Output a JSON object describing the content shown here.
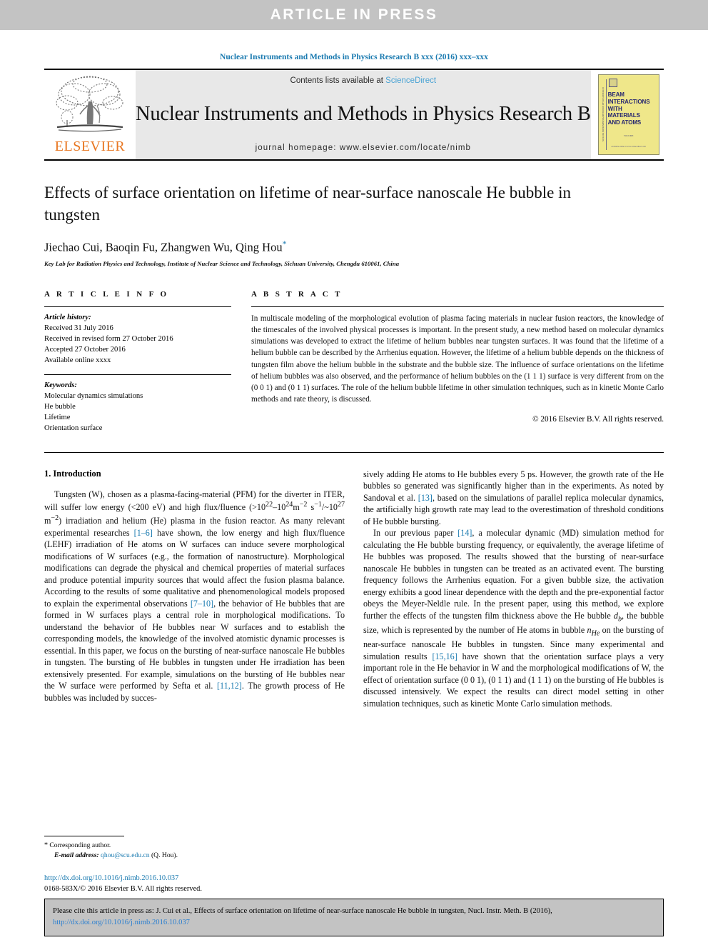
{
  "banner": {
    "text": "ARTICLE  IN  PRESS"
  },
  "running_head": "Nuclear Instruments and Methods in Physics Research B xxx (2016) xxx–xxx",
  "masthead": {
    "contents_prefix": "Contents lists available at ",
    "contents_link": "ScienceDirect",
    "journal_title": "Nuclear Instruments and Methods in Physics Research B",
    "homepage": "journal homepage: www.elsevier.com/locate/nimb",
    "publisher_logo_text": "ELSEVIER",
    "cover": {
      "title_lines": [
        "BEAM",
        "INTERACTIONS",
        "WITH",
        "MATERIALS",
        "AND ATOMS"
      ],
      "spine_text": "NUCLEAR INSTRUMENTS & METHODS IN PHYSICS RESEARCH",
      "volume_text": "VOLUME",
      "footer_text": "Available online at www.sciencedirect.com"
    }
  },
  "article": {
    "title": "Effects of surface orientation on lifetime of near-surface nanoscale He bubble in tungsten",
    "authors": "Jiechao Cui, Baoqin Fu, Zhangwen Wu, Qing Hou",
    "corresponding_marker": "*",
    "affiliation": "Key Lab for Radiation Physics and Technology, Institute of Nuclear Science and Technology, Sichuan University, Chengdu 610061, China"
  },
  "article_info": {
    "heading": "A R T I C L E   I N F O",
    "history_label": "Article history:",
    "history": [
      "Received 31 July 2016",
      "Received in revised form 27 October 2016",
      "Accepted 27 October 2016",
      "Available online xxxx"
    ],
    "keywords_label": "Keywords:",
    "keywords": [
      "Molecular dynamics simulations",
      "He bubble",
      "Lifetime",
      "Orientation surface"
    ]
  },
  "abstract": {
    "heading": "A B S T R A C T",
    "text": "In multiscale modeling of the morphological evolution of plasma facing materials in nuclear fusion reactors, the knowledge of the timescales of the involved physical processes is important. In the present study, a new method based on molecular dynamics simulations was developed to extract the lifetime of helium bubbles near tungsten surfaces. It was found that the lifetime of a helium bubble can be described by the Arrhenius equation. However, the lifetime of a helium bubble depends on the thickness of tungsten film above the helium bubble in the substrate and the bubble size. The influence of surface orientations on the lifetime of helium bubbles was also observed, and the performance of helium bubbles on the (1 1 1) surface is very different from on the (0 0 1) and (0 1 1) surfaces. The role of the helium bubble lifetime in other simulation techniques, such as in kinetic Monte Carlo methods and rate theory, is discussed.",
    "copyright": "© 2016 Elsevier B.V. All rights reserved."
  },
  "body": {
    "section_title": "1. Introduction",
    "left_para1_a": "Tungsten (W), chosen as a plasma-facing-material (PFM) for the diverter in ITER, will suffer low energy (<200 eV) and high flux/fluence (>10",
    "left_para1_sup1": "22",
    "left_para1_b": "–10",
    "left_para1_sup2": "24",
    "left_para1_c": "m",
    "left_para1_sup3": "−2",
    "left_para1_d": " s",
    "left_para1_sup4": "−1",
    "left_para1_e": "/~10",
    "left_para1_sup5": "27",
    "left_para1_f": " m",
    "left_para1_sup6": "−2",
    "left_para1_g": ") irradiation and helium (He) plasma in the fusion reactor. As many relevant experimental researches ",
    "ref_1_6": "[1–6]",
    "left_para1_h": " have shown, the low energy and high flux/fluence (LEHF) irradiation of He atoms on W surfaces can induce severe morphological modifications of W surfaces (e.g., the formation of nanostructure). Morphological modifications can degrade the physical and chemical properties of material surfaces and produce potential impurity sources that would affect the fusion plasma balance. According to the results of some qualitative and phenomenological models proposed to explain the experimental observations ",
    "ref_7_10": "[7–10]",
    "left_para1_i": ", the behavior of He bubbles that are formed in W surfaces plays a central role in morphological modifications. To understand the behavior of He bubbles near W surfaces and to establish the corresponding models, the knowledge of the involved atomistic dynamic processes is essential. In this paper, we focus on the bursting of near-surface nanoscale He bubbles in tungsten. The bursting of He bubbles in tungsten under He irradiation has been extensively presented. For example, simulations on the bursting of He bubbles near the W surface were performed by Sefta et al. ",
    "ref_11_12": "[11,12]",
    "left_para1_j": ". The growth process of He bubbles was included by succes-",
    "right_para1_a": "sively adding He atoms to He bubbles every 5 ps. However, the growth rate of the He bubbles so generated was significantly higher than in the experiments. As noted by Sandoval et al. ",
    "ref_13": "[13]",
    "right_para1_b": ", based on the simulations of parallel replica molecular dynamics, the artificially high growth rate may lead to the overestimation of threshold conditions of He bubble bursting.",
    "right_para2_a": "In our previous paper ",
    "ref_14": "[14]",
    "right_para2_b": ", a molecular dynamic (MD) simulation method for calculating the He bubble bursting frequency, or equivalently, the average lifetime of He bubbles was proposed. The results showed that the bursting of near-surface nanoscale He bubbles in tungsten can be treated as an activated event. The bursting frequency follows the Arrhenius equation. For a given bubble size, the activation energy exhibits a good linear dependence with the depth and the pre-exponential factor obeys the Meyer-Neldle rule. In the present paper, using this method, we explore further the effects of the tungsten film thickness above the He bubble ",
    "right_para2_var1": "d",
    "right_para2_var1_sub": "b",
    "right_para2_c": ", the bubble size, which is represented by the number of He atoms in bubble ",
    "right_para2_var2": "n",
    "right_para2_var2_sub": "He",
    "right_para2_d": " on the bursting of near-surface nanoscale He bubbles in tungsten. Since many experimental and simulation results ",
    "ref_15_16": "[15,16]",
    "right_para2_e": " have shown that the orientation surface plays a very important role in the He behavior in W and the morphological modifications of W, the effect of orientation surface (0 0 1), (0 1 1) and (1 1 1) on the bursting of He bubbles is discussed intensively. We expect the results can direct model setting in other simulation techniques, such as kinetic Monte Carlo simulation methods."
  },
  "footnote": {
    "star": "*",
    "corresponding": "Corresponding author.",
    "email_label": "E-mail address:",
    "email": "qhou@scu.edu.cn",
    "email_suffix": "(Q. Hou)."
  },
  "doi_block": {
    "doi_url": "http://dx.doi.org/10.1016/j.nimb.2016.10.037",
    "issn_line": "0168-583X/© 2016 Elsevier B.V. All rights reserved."
  },
  "cite_box": {
    "text_a": "Please cite this article in press as: J. Cui et al., Effects of surface orientation on lifetime of near-surface nanoscale He bubble in tungsten, Nucl. Instr. Meth. B (2016), ",
    "link": "http://dx.doi.org/10.1016/j.nimb.2016.10.037"
  },
  "colors": {
    "link_blue": "#1a7ab0",
    "banner_gray": "#c3c3c3",
    "elsevier_orange": "#e87722",
    "masthead_gray": "#e8e8e8",
    "cover_yellow": "#efe78a"
  }
}
